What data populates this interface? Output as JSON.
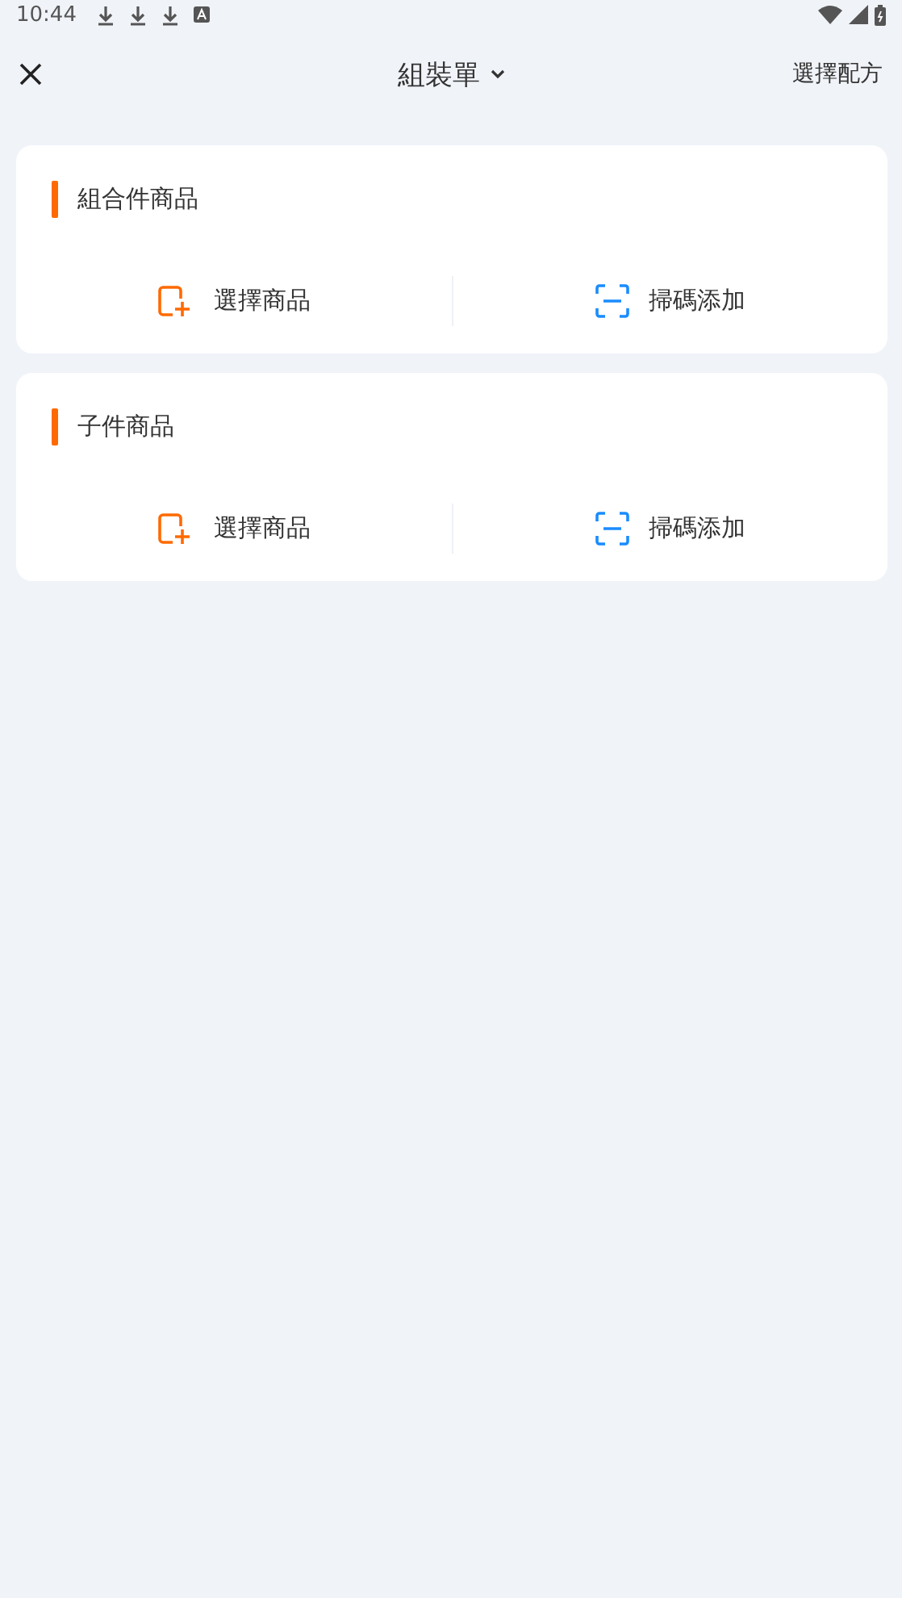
{
  "status_bar": {
    "time": "10:44"
  },
  "header": {
    "title": "組裝單",
    "action": "選擇配方"
  },
  "sections": [
    {
      "title": "組合件商品",
      "actions": [
        {
          "kind": "select",
          "label": "選擇商品"
        },
        {
          "kind": "scan",
          "label": "掃碼添加"
        }
      ]
    },
    {
      "title": "子件商品",
      "actions": [
        {
          "kind": "select",
          "label": "選擇商品"
        },
        {
          "kind": "scan",
          "label": "掃碼添加"
        }
      ]
    }
  ]
}
